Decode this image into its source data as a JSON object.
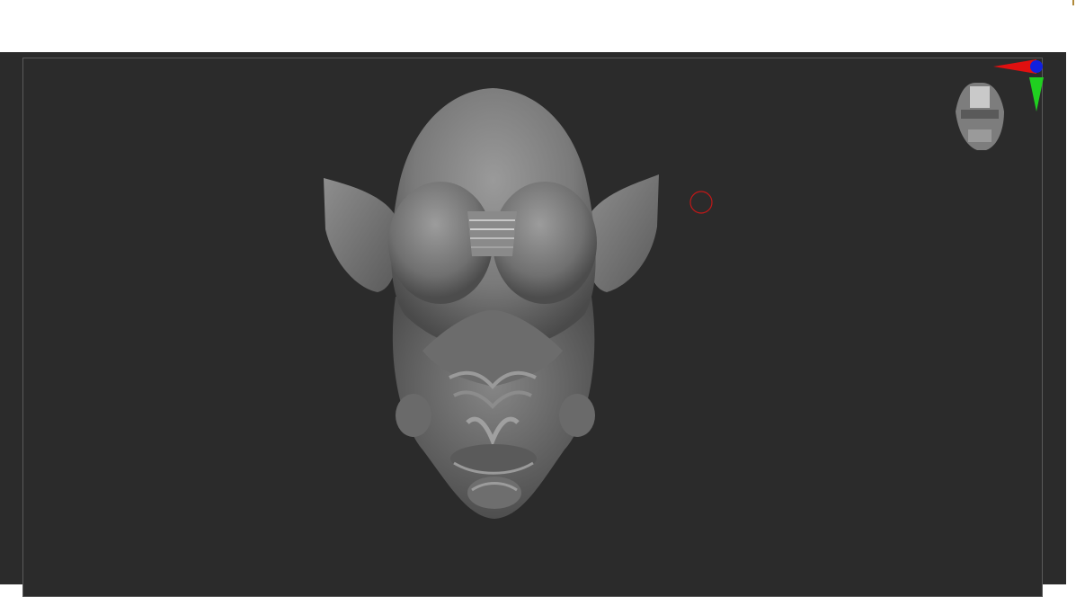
{
  "app": {
    "viewport_name": "3D canvas",
    "background": "#2b2b2b"
  },
  "model": {
    "subject": "creature-head-sculpt",
    "material_color": "#8c8c8c"
  },
  "gizmo": {
    "x_axis_color": "#e01010",
    "y_axis_color": "#20d020",
    "z_axis_color": "#1020e0"
  },
  "brush": {
    "cursor_color": "#c01818"
  }
}
